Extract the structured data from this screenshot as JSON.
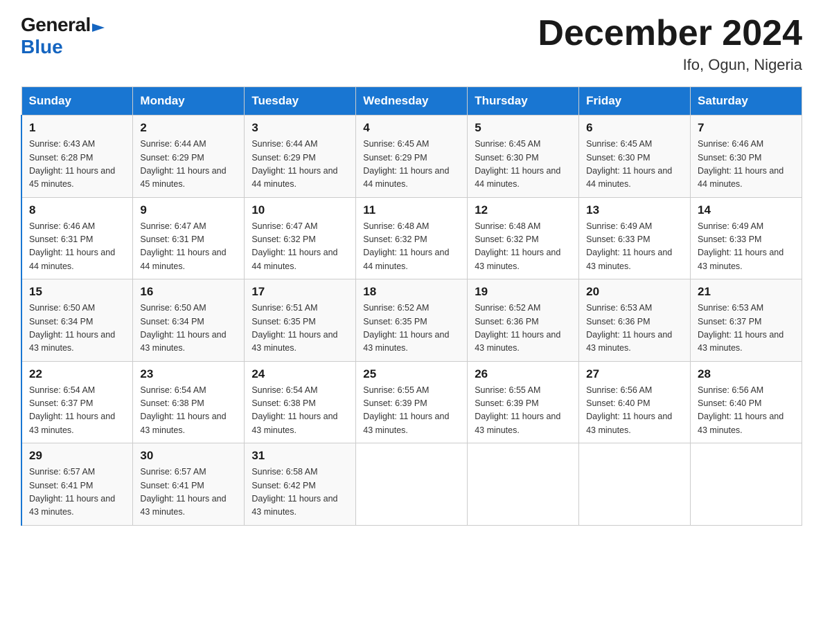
{
  "header": {
    "logo_general": "General",
    "logo_blue": "Blue",
    "title": "December 2024",
    "subtitle": "Ifo, Ogun, Nigeria"
  },
  "days_of_week": [
    "Sunday",
    "Monday",
    "Tuesday",
    "Wednesday",
    "Thursday",
    "Friday",
    "Saturday"
  ],
  "weeks": [
    [
      {
        "day": "1",
        "sunrise": "6:43 AM",
        "sunset": "6:28 PM",
        "daylight": "11 hours and 45 minutes."
      },
      {
        "day": "2",
        "sunrise": "6:44 AM",
        "sunset": "6:29 PM",
        "daylight": "11 hours and 45 minutes."
      },
      {
        "day": "3",
        "sunrise": "6:44 AM",
        "sunset": "6:29 PM",
        "daylight": "11 hours and 44 minutes."
      },
      {
        "day": "4",
        "sunrise": "6:45 AM",
        "sunset": "6:29 PM",
        "daylight": "11 hours and 44 minutes."
      },
      {
        "day": "5",
        "sunrise": "6:45 AM",
        "sunset": "6:30 PM",
        "daylight": "11 hours and 44 minutes."
      },
      {
        "day": "6",
        "sunrise": "6:45 AM",
        "sunset": "6:30 PM",
        "daylight": "11 hours and 44 minutes."
      },
      {
        "day": "7",
        "sunrise": "6:46 AM",
        "sunset": "6:30 PM",
        "daylight": "11 hours and 44 minutes."
      }
    ],
    [
      {
        "day": "8",
        "sunrise": "6:46 AM",
        "sunset": "6:31 PM",
        "daylight": "11 hours and 44 minutes."
      },
      {
        "day": "9",
        "sunrise": "6:47 AM",
        "sunset": "6:31 PM",
        "daylight": "11 hours and 44 minutes."
      },
      {
        "day": "10",
        "sunrise": "6:47 AM",
        "sunset": "6:32 PM",
        "daylight": "11 hours and 44 minutes."
      },
      {
        "day": "11",
        "sunrise": "6:48 AM",
        "sunset": "6:32 PM",
        "daylight": "11 hours and 44 minutes."
      },
      {
        "day": "12",
        "sunrise": "6:48 AM",
        "sunset": "6:32 PM",
        "daylight": "11 hours and 43 minutes."
      },
      {
        "day": "13",
        "sunrise": "6:49 AM",
        "sunset": "6:33 PM",
        "daylight": "11 hours and 43 minutes."
      },
      {
        "day": "14",
        "sunrise": "6:49 AM",
        "sunset": "6:33 PM",
        "daylight": "11 hours and 43 minutes."
      }
    ],
    [
      {
        "day": "15",
        "sunrise": "6:50 AM",
        "sunset": "6:34 PM",
        "daylight": "11 hours and 43 minutes."
      },
      {
        "day": "16",
        "sunrise": "6:50 AM",
        "sunset": "6:34 PM",
        "daylight": "11 hours and 43 minutes."
      },
      {
        "day": "17",
        "sunrise": "6:51 AM",
        "sunset": "6:35 PM",
        "daylight": "11 hours and 43 minutes."
      },
      {
        "day": "18",
        "sunrise": "6:52 AM",
        "sunset": "6:35 PM",
        "daylight": "11 hours and 43 minutes."
      },
      {
        "day": "19",
        "sunrise": "6:52 AM",
        "sunset": "6:36 PM",
        "daylight": "11 hours and 43 minutes."
      },
      {
        "day": "20",
        "sunrise": "6:53 AM",
        "sunset": "6:36 PM",
        "daylight": "11 hours and 43 minutes."
      },
      {
        "day": "21",
        "sunrise": "6:53 AM",
        "sunset": "6:37 PM",
        "daylight": "11 hours and 43 minutes."
      }
    ],
    [
      {
        "day": "22",
        "sunrise": "6:54 AM",
        "sunset": "6:37 PM",
        "daylight": "11 hours and 43 minutes."
      },
      {
        "day": "23",
        "sunrise": "6:54 AM",
        "sunset": "6:38 PM",
        "daylight": "11 hours and 43 minutes."
      },
      {
        "day": "24",
        "sunrise": "6:54 AM",
        "sunset": "6:38 PM",
        "daylight": "11 hours and 43 minutes."
      },
      {
        "day": "25",
        "sunrise": "6:55 AM",
        "sunset": "6:39 PM",
        "daylight": "11 hours and 43 minutes."
      },
      {
        "day": "26",
        "sunrise": "6:55 AM",
        "sunset": "6:39 PM",
        "daylight": "11 hours and 43 minutes."
      },
      {
        "day": "27",
        "sunrise": "6:56 AM",
        "sunset": "6:40 PM",
        "daylight": "11 hours and 43 minutes."
      },
      {
        "day": "28",
        "sunrise": "6:56 AM",
        "sunset": "6:40 PM",
        "daylight": "11 hours and 43 minutes."
      }
    ],
    [
      {
        "day": "29",
        "sunrise": "6:57 AM",
        "sunset": "6:41 PM",
        "daylight": "11 hours and 43 minutes."
      },
      {
        "day": "30",
        "sunrise": "6:57 AM",
        "sunset": "6:41 PM",
        "daylight": "11 hours and 43 minutes."
      },
      {
        "day": "31",
        "sunrise": "6:58 AM",
        "sunset": "6:42 PM",
        "daylight": "11 hours and 43 minutes."
      },
      null,
      null,
      null,
      null
    ]
  ]
}
